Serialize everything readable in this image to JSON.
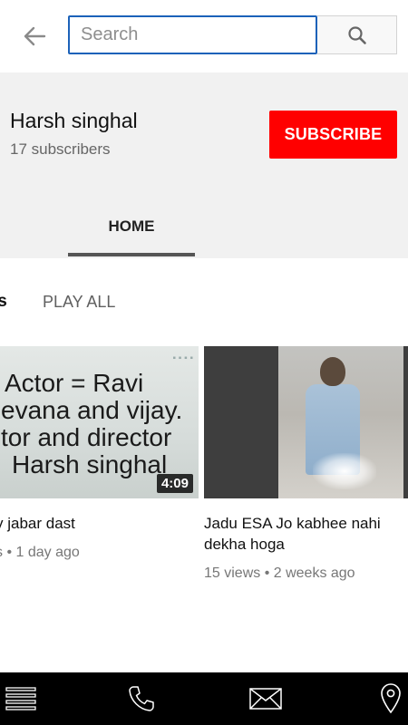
{
  "search": {
    "placeholder": "Search"
  },
  "icons": {
    "back": "arrow-left-icon",
    "search": "search-icon",
    "menu": "menu-icon",
    "phone": "phone-icon",
    "mail": "mail-icon",
    "location": "location-pin-icon"
  },
  "channel": {
    "name": "Harsh singhal",
    "subscribers": "17 subscribers",
    "subscribe_label": "SUBSCRIBE"
  },
  "tabs": [
    {
      "label": "HOME",
      "active": true
    }
  ],
  "section": {
    "title": "ls",
    "play_all_label": "PLAY ALL"
  },
  "videos": [
    {
      "thumbnail_text": [
        "Actor = Ravi",
        "evana and vijay.",
        "tor and  director",
        "Harsh singhal"
      ],
      "duration": "4:09",
      "title": "y jabar dast",
      "meta": "s • 1 day ago"
    },
    {
      "title": "Jadu ESA Jo kabhee nahi dekha hoga",
      "meta": "15 views • 2 weeks ago"
    }
  ],
  "colors": {
    "subscribe": "#ff0000",
    "search_focus": "#1c62b9",
    "header_bg": "#f1f1f1",
    "bottom_nav": "#000000"
  }
}
